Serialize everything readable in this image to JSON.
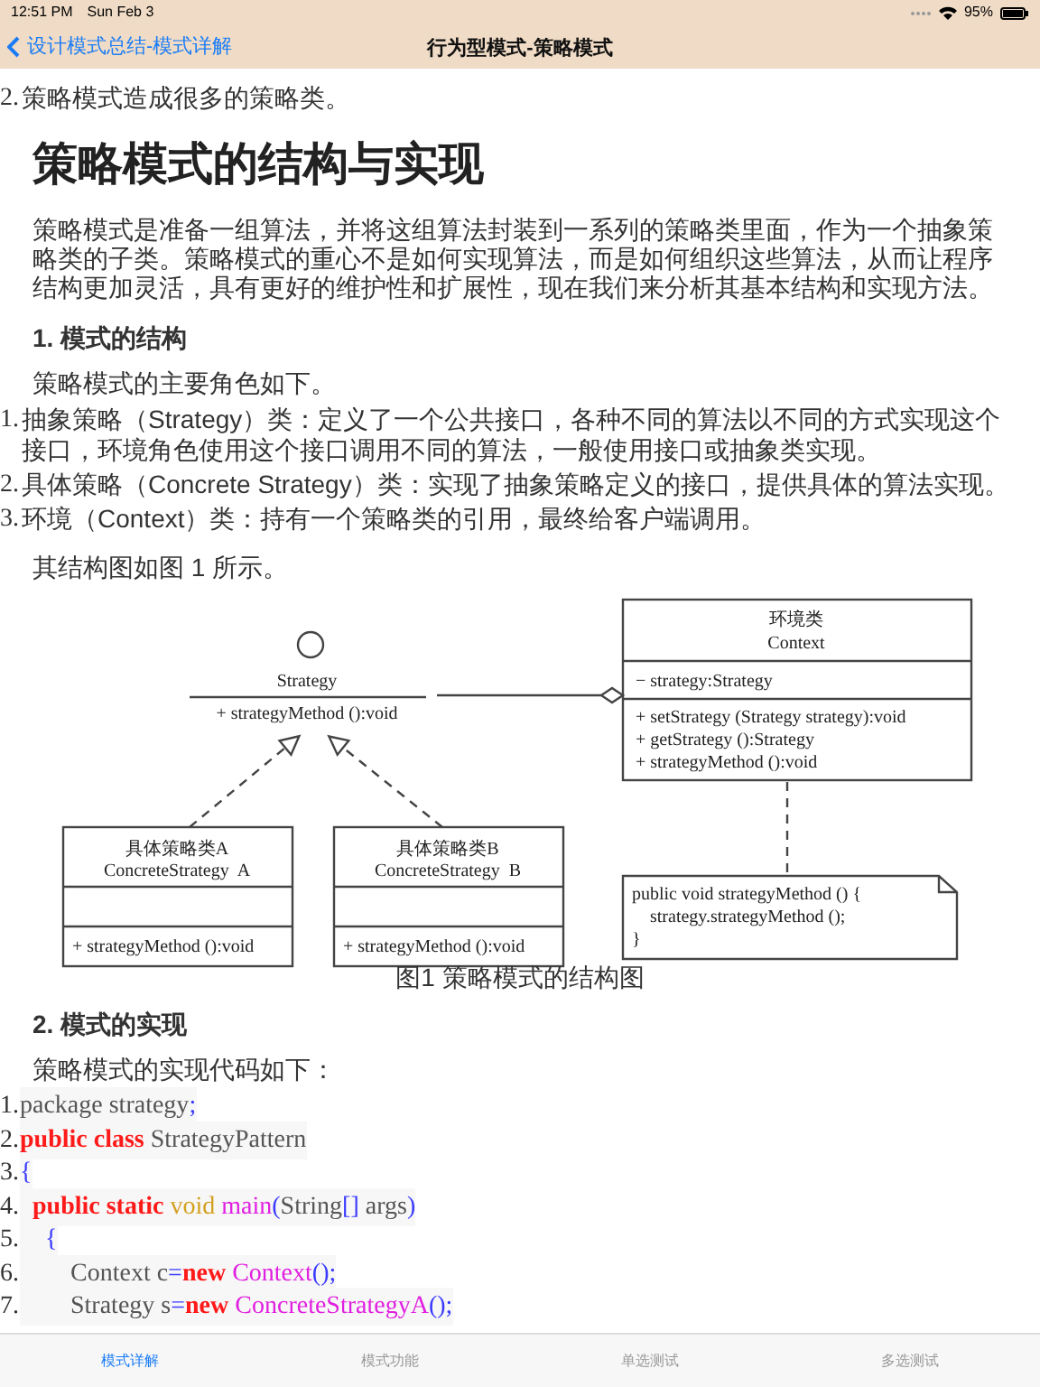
{
  "status_bar": {
    "time": "12:51 PM",
    "date": "Sun Feb 3",
    "battery": "95%"
  },
  "nav": {
    "back": "设计模式总结-模式详解",
    "title": "行为型模式-策略模式"
  },
  "intro_item": {
    "number": "2.",
    "text": "策略模式造成很多的策略类。"
  },
  "heading": "策略模式的结构与实现",
  "paragraph": "策略模式是准备一组算法，并将这组算法封装到一系列的策略类里面，作为一个抽象策略类的子类。策略模式的重心不是如何实现算法，而是如何组织这些算法，从而让程序结构更加灵活，具有更好的维护性和扩展性，现在我们来分析其基本结构和实现方法。",
  "section1": {
    "title": "1. 模式的结构",
    "lead": "策略模式的主要角色如下。",
    "roles": [
      {
        "number": "1.",
        "text": "抽象策略（Strategy）类：定义了一个公共接口，各种不同的算法以不同的方式实现这个接口，环境角色使用这个接口调用不同的算法，一般使用接口或抽象类实现。"
      },
      {
        "number": "2.",
        "text": "具体策略（Concrete Strategy）类：实现了抽象策略定义的接口，提供具体的算法实现。"
      },
      {
        "number": "3.",
        "text": "环境（Context）类：持有一个策略类的引用，最终给客户端调用。"
      }
    ],
    "figure_ref": "其结构图如图 1 所示。"
  },
  "diagram": {
    "interface": {
      "name": "Strategy",
      "method": "+ strategyMethod ():void"
    },
    "context": {
      "name_cn": "环境类",
      "name": "Context",
      "field": "− strategy:Strategy",
      "methods": [
        "+ setStrategy (Strategy strategy):void",
        "+ getStrategy ():Strategy",
        "+ strategyMethod ():void"
      ]
    },
    "concrete": [
      {
        "name_cn": "具体策略类A",
        "name": "ConcreteStrategy  A",
        "method": "+ strategyMethod ():void"
      },
      {
        "name_cn": "具体策略类B",
        "name": "ConcreteStrategy  B",
        "method": "+ strategyMethod ():void"
      }
    ],
    "note": [
      "public void strategyMethod () {",
      "    strategy.strategyMethod ();",
      "}"
    ],
    "caption": "图1 策略模式的结构图"
  },
  "section2": {
    "title": "2. 模式的实现",
    "lead": "策略模式的实现代码如下：",
    "code": [
      {
        "number": "1.",
        "tokens": [
          {
            "kind": "plain",
            "text": "package strategy"
          },
          {
            "kind": "punct",
            "text": ";"
          }
        ]
      },
      {
        "number": "2.",
        "tokens": [
          {
            "kind": "keyword",
            "text": "public class"
          },
          {
            "kind": "plain",
            "text": " StrategyPattern"
          }
        ]
      },
      {
        "number": "3.",
        "tokens": [
          {
            "kind": "punct",
            "text": "{"
          }
        ]
      },
      {
        "number": "4.",
        "tokens": [
          {
            "kind": "keyword",
            "text": "  public static"
          },
          {
            "kind": "type",
            "text": " void"
          },
          {
            "kind": "name",
            "text": " main"
          },
          {
            "kind": "punct",
            "text": "("
          },
          {
            "kind": "plain",
            "text": "String"
          },
          {
            "kind": "punct",
            "text": "[]"
          },
          {
            "kind": "plain",
            "text": " args"
          },
          {
            "kind": "punct",
            "text": ")"
          }
        ]
      },
      {
        "number": "5.",
        "tokens": [
          {
            "kind": "punct",
            "text": "    {"
          }
        ]
      },
      {
        "number": "6.",
        "tokens": [
          {
            "kind": "plain",
            "text": "        Context c"
          },
          {
            "kind": "punct",
            "text": "="
          },
          {
            "kind": "keyword",
            "text": "new"
          },
          {
            "kind": "name",
            "text": " Context"
          },
          {
            "kind": "punct",
            "text": "();"
          }
        ]
      },
      {
        "number": "7.",
        "tokens": [
          {
            "kind": "plain",
            "text": "        Strategy s"
          },
          {
            "kind": "punct",
            "text": "="
          },
          {
            "kind": "keyword",
            "text": "new"
          },
          {
            "kind": "name",
            "text": " ConcreteStrategyA"
          },
          {
            "kind": "punct",
            "text": "();"
          }
        ]
      }
    ]
  },
  "tabs": [
    {
      "label": "模式详解",
      "selected": true
    },
    {
      "label": "模式功能",
      "selected": false
    },
    {
      "label": "单选测试",
      "selected": false
    },
    {
      "label": "多选测试",
      "selected": false
    }
  ]
}
